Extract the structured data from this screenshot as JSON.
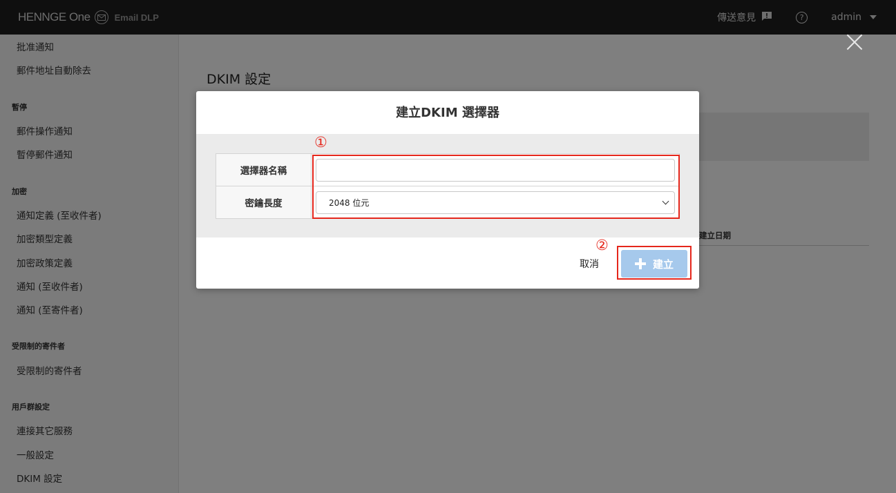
{
  "header": {
    "brand_name": "HENNGE One",
    "product_name": "Email DLP",
    "feedback_label": "傳送意見",
    "help_label": "?",
    "user_label": "admin"
  },
  "sidebar": {
    "items_top": [
      "批准通知",
      "郵件地址自動除去"
    ],
    "section_pause": "暫停",
    "items_pause": [
      "郵件操作通知",
      "暫停郵件通知"
    ],
    "section_encrypt": "加密",
    "items_encrypt": [
      "通知定義 (至收件者)",
      "加密類型定義",
      "加密政策定義",
      "通知 (至收件者)",
      "通知 (至寄件者)"
    ],
    "section_restricted": "受限制的寄件者",
    "items_restricted": [
      "受限制的寄件者"
    ],
    "section_group": "用戶群設定",
    "items_group": [
      "連接其它服務",
      "一般設定",
      "DKIM 設定"
    ]
  },
  "main": {
    "page_title": "DKIM 設定",
    "table_header_created": "建立日期"
  },
  "modal": {
    "title": "建立DKIM 選擇器",
    "selector_name_label": "選擇器名稱",
    "selector_name_value": "",
    "key_length_label": "密鑰長度",
    "key_length_selected": "2048 位元",
    "cancel_label": "取消",
    "create_label": "建立"
  },
  "annotations": {
    "marker_1": "①",
    "marker_2": "②",
    "color": "#e5261b"
  },
  "colors": {
    "topbar": "#1e1e1e",
    "create_button": "#a6c9ec"
  }
}
